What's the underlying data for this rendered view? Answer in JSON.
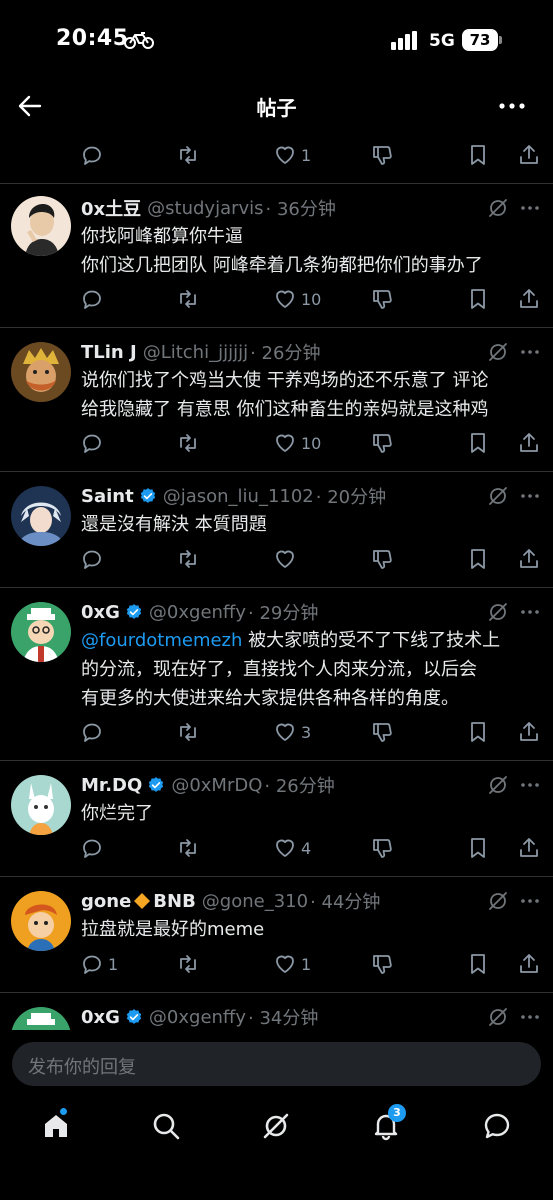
{
  "status_bar": {
    "time": "20:45",
    "network": "5G",
    "battery": "73"
  },
  "header": {
    "title": "帖子"
  },
  "reply": {
    "placeholder": "发布你的回复"
  },
  "nav": {
    "notifications_badge": "3"
  },
  "top_actions": {
    "likes": "1"
  },
  "tweets": [
    {
      "name": "0x土豆",
      "handle": "@studyjarvis",
      "time": "· 36分钟",
      "verified": false,
      "lines": [
        "你找阿峰都算你牛逼",
        "你们这几把团队 阿峰牵着几条狗都把你们的事办了"
      ],
      "replies": "",
      "retweets": "",
      "likes": "10"
    },
    {
      "name": "TLin J",
      "handle": "@Litchi_jjjjjj",
      "time": "· 26分钟",
      "verified": false,
      "lines": [
        "说你们找了个鸡当大使  干养鸡场的还不乐意了 评论",
        "给我隐藏了 有意思 你们这种畜生的亲妈就是这种鸡"
      ],
      "replies": "",
      "retweets": "",
      "likes": "10"
    },
    {
      "name": "Saint",
      "handle": "@jason_liu_1102",
      "time": "· 20分钟",
      "verified": true,
      "lines": [
        "還是沒有解決 本質問題"
      ],
      "replies": "",
      "retweets": "",
      "likes": ""
    },
    {
      "name": "0xG",
      "handle": "@0xgenffy",
      "time": "· 29分钟",
      "verified": true,
      "mention": "@fourdotmemezh",
      "lines": [
        " 被大家喷的受不了下线了技术上",
        "的分流，现在好了，直接找个人肉来分流，以后会",
        "有更多的大使进来给大家提供各种各样的角度。"
      ],
      "replies": "",
      "retweets": "",
      "likes": "3"
    },
    {
      "name": "Mr.DQ",
      "handle": "@0xMrDQ",
      "time": "· 26分钟",
      "verified": true,
      "lines": [
        "你烂完了"
      ],
      "replies": "",
      "retweets": "",
      "likes": "4"
    },
    {
      "name_a": "gone",
      "name_b": "BNB",
      "handle": "@gone_310",
      "time": "· 44分钟",
      "verified": false,
      "lines": [
        "拉盘就是最好的meme"
      ],
      "replies": "1",
      "retweets": "",
      "likes": "1"
    },
    {
      "name": "0xG",
      "handle": "@0xgenffy",
      "time": "· 34分钟",
      "verified": true,
      "lines": [],
      "replies": "",
      "retweets": "",
      "likes": ""
    }
  ]
}
